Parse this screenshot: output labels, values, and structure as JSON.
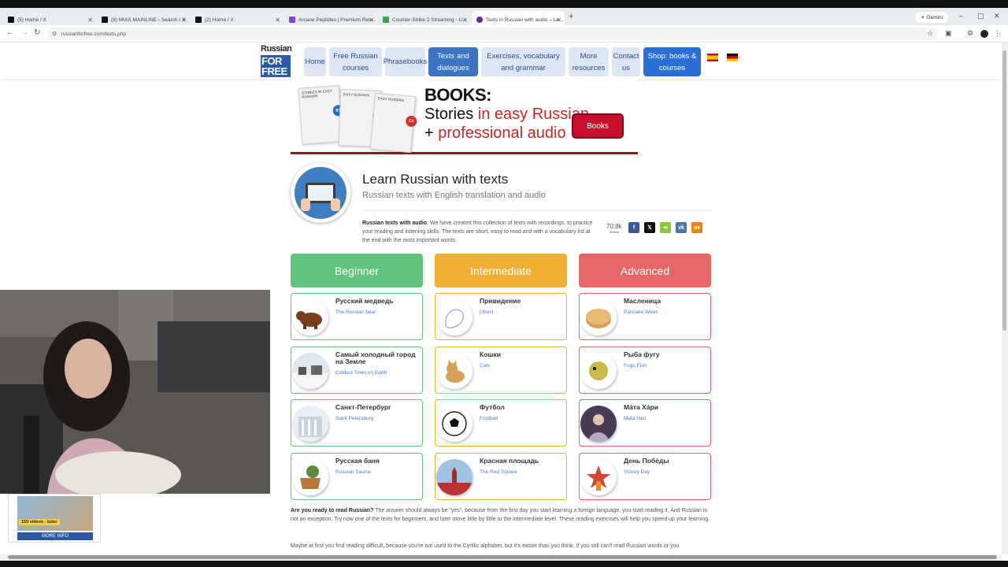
{
  "browser": {
    "tabs": [
      {
        "label": "(5) Home / X",
        "fav": "#111"
      },
      {
        "label": "(8) MIAS MAINLINE - Search / X",
        "fav": "#111"
      },
      {
        "label": "(2) Home / X",
        "fav": "#111"
      },
      {
        "label": "Arcane Peptides | Premium Res...",
        "fav": "#7a4bd1"
      },
      {
        "label": "Counter-Strike 2 Streaming - Li...",
        "fav": "#2fa84f"
      },
      {
        "label": "Texts in Russian with audio – Le...",
        "fav": "#5b2aa0"
      }
    ],
    "gemini_label": "Gemini",
    "url": "russianforfree.com/texts.php"
  },
  "logo": {
    "line1": "Russian",
    "line2": "FOR FREE"
  },
  "nav": [
    {
      "label": "Home"
    },
    {
      "label": "Free Russian courses"
    },
    {
      "label": "Phrasebooks"
    },
    {
      "label": "Texts and dialogues"
    },
    {
      "label": "Exercises, vocabulary and grammar"
    },
    {
      "label": "More resources"
    },
    {
      "label": "Contact us"
    },
    {
      "label": "Shop: books & courses"
    }
  ],
  "banner": {
    "line1": "BOOKS:",
    "line2_a": "Stories ",
    "line2_b": "in easy Russian",
    "line3_plus": "+ ",
    "line3": "professional audio",
    "button": "Books",
    "cover_title": "STORIES IN EASY RUSSIAN",
    "badges": [
      "B1",
      "A2",
      "C1"
    ]
  },
  "header": {
    "title": "Learn Russian with texts",
    "subtitle": "Russian texts with English translation and audio",
    "intro_bold": "Russian texts with audio",
    "intro_rest": ": We have created this collection of texts with recordings, to practice your reading and listening skills. The texts are short, easy to read and with a vocabulary list at the end with the most important words.",
    "shares_count": "70.8k",
    "shares_label": "Shares"
  },
  "levels": [
    "Beginner",
    "Intermediate",
    "Advanced"
  ],
  "colors": {
    "beginner": "#62c37a",
    "intermediate": "#f0b033",
    "advanced": "#e56767",
    "link": "#4d7dbf",
    "nav_active": "#3a74c2",
    "banner_red": "#c8102e"
  },
  "cards": {
    "beginner": [
      {
        "ru": "Русский медведь",
        "en": "The Russian bear"
      },
      {
        "ru": "Самый холодный город на Земле",
        "en": "Coldest Town on Earth"
      },
      {
        "ru": "Санкт-Петербург",
        "en": "Saint Petersburg"
      },
      {
        "ru": "Русская баня",
        "en": "Russian Sauna"
      }
    ],
    "intermediate": [
      {
        "ru": "Привидение",
        "en": "Ghost"
      },
      {
        "ru": "Кошки",
        "en": "Cats"
      },
      {
        "ru": "Футбол",
        "en": "Football"
      },
      {
        "ru": "Красная площадь",
        "en": "The Red Square"
      }
    ],
    "advanced": [
      {
        "ru": "Масленица",
        "en": "Pancake Week"
      },
      {
        "ru": "Рыба фугу",
        "en": "Fugu Fish"
      },
      {
        "ru": "Ма́та Ха́ри",
        "en": "Mata Hari"
      },
      {
        "ru": "День Побе́ды",
        "en": "Victory Day"
      }
    ]
  },
  "body": {
    "p1_bold": "Are you ready to read Russian?",
    "p1_rest": " The answer should always be \"yes\", because from the first day you start learning a foreign language, you start reading it. And Russian is not an exception. Try now one of the texts for beginners, and later move little by little to the intermediate level. These reading exercises will help you speed up your learning.",
    "p2": "Maybe at first you find reading difficult, because you're not used to the Cyrillic alphabet, but it's easier than you think. If you still can't read Russian words or you"
  },
  "ad": {
    "tag": "150 videos - tutor",
    "button": "MORE INFO"
  }
}
